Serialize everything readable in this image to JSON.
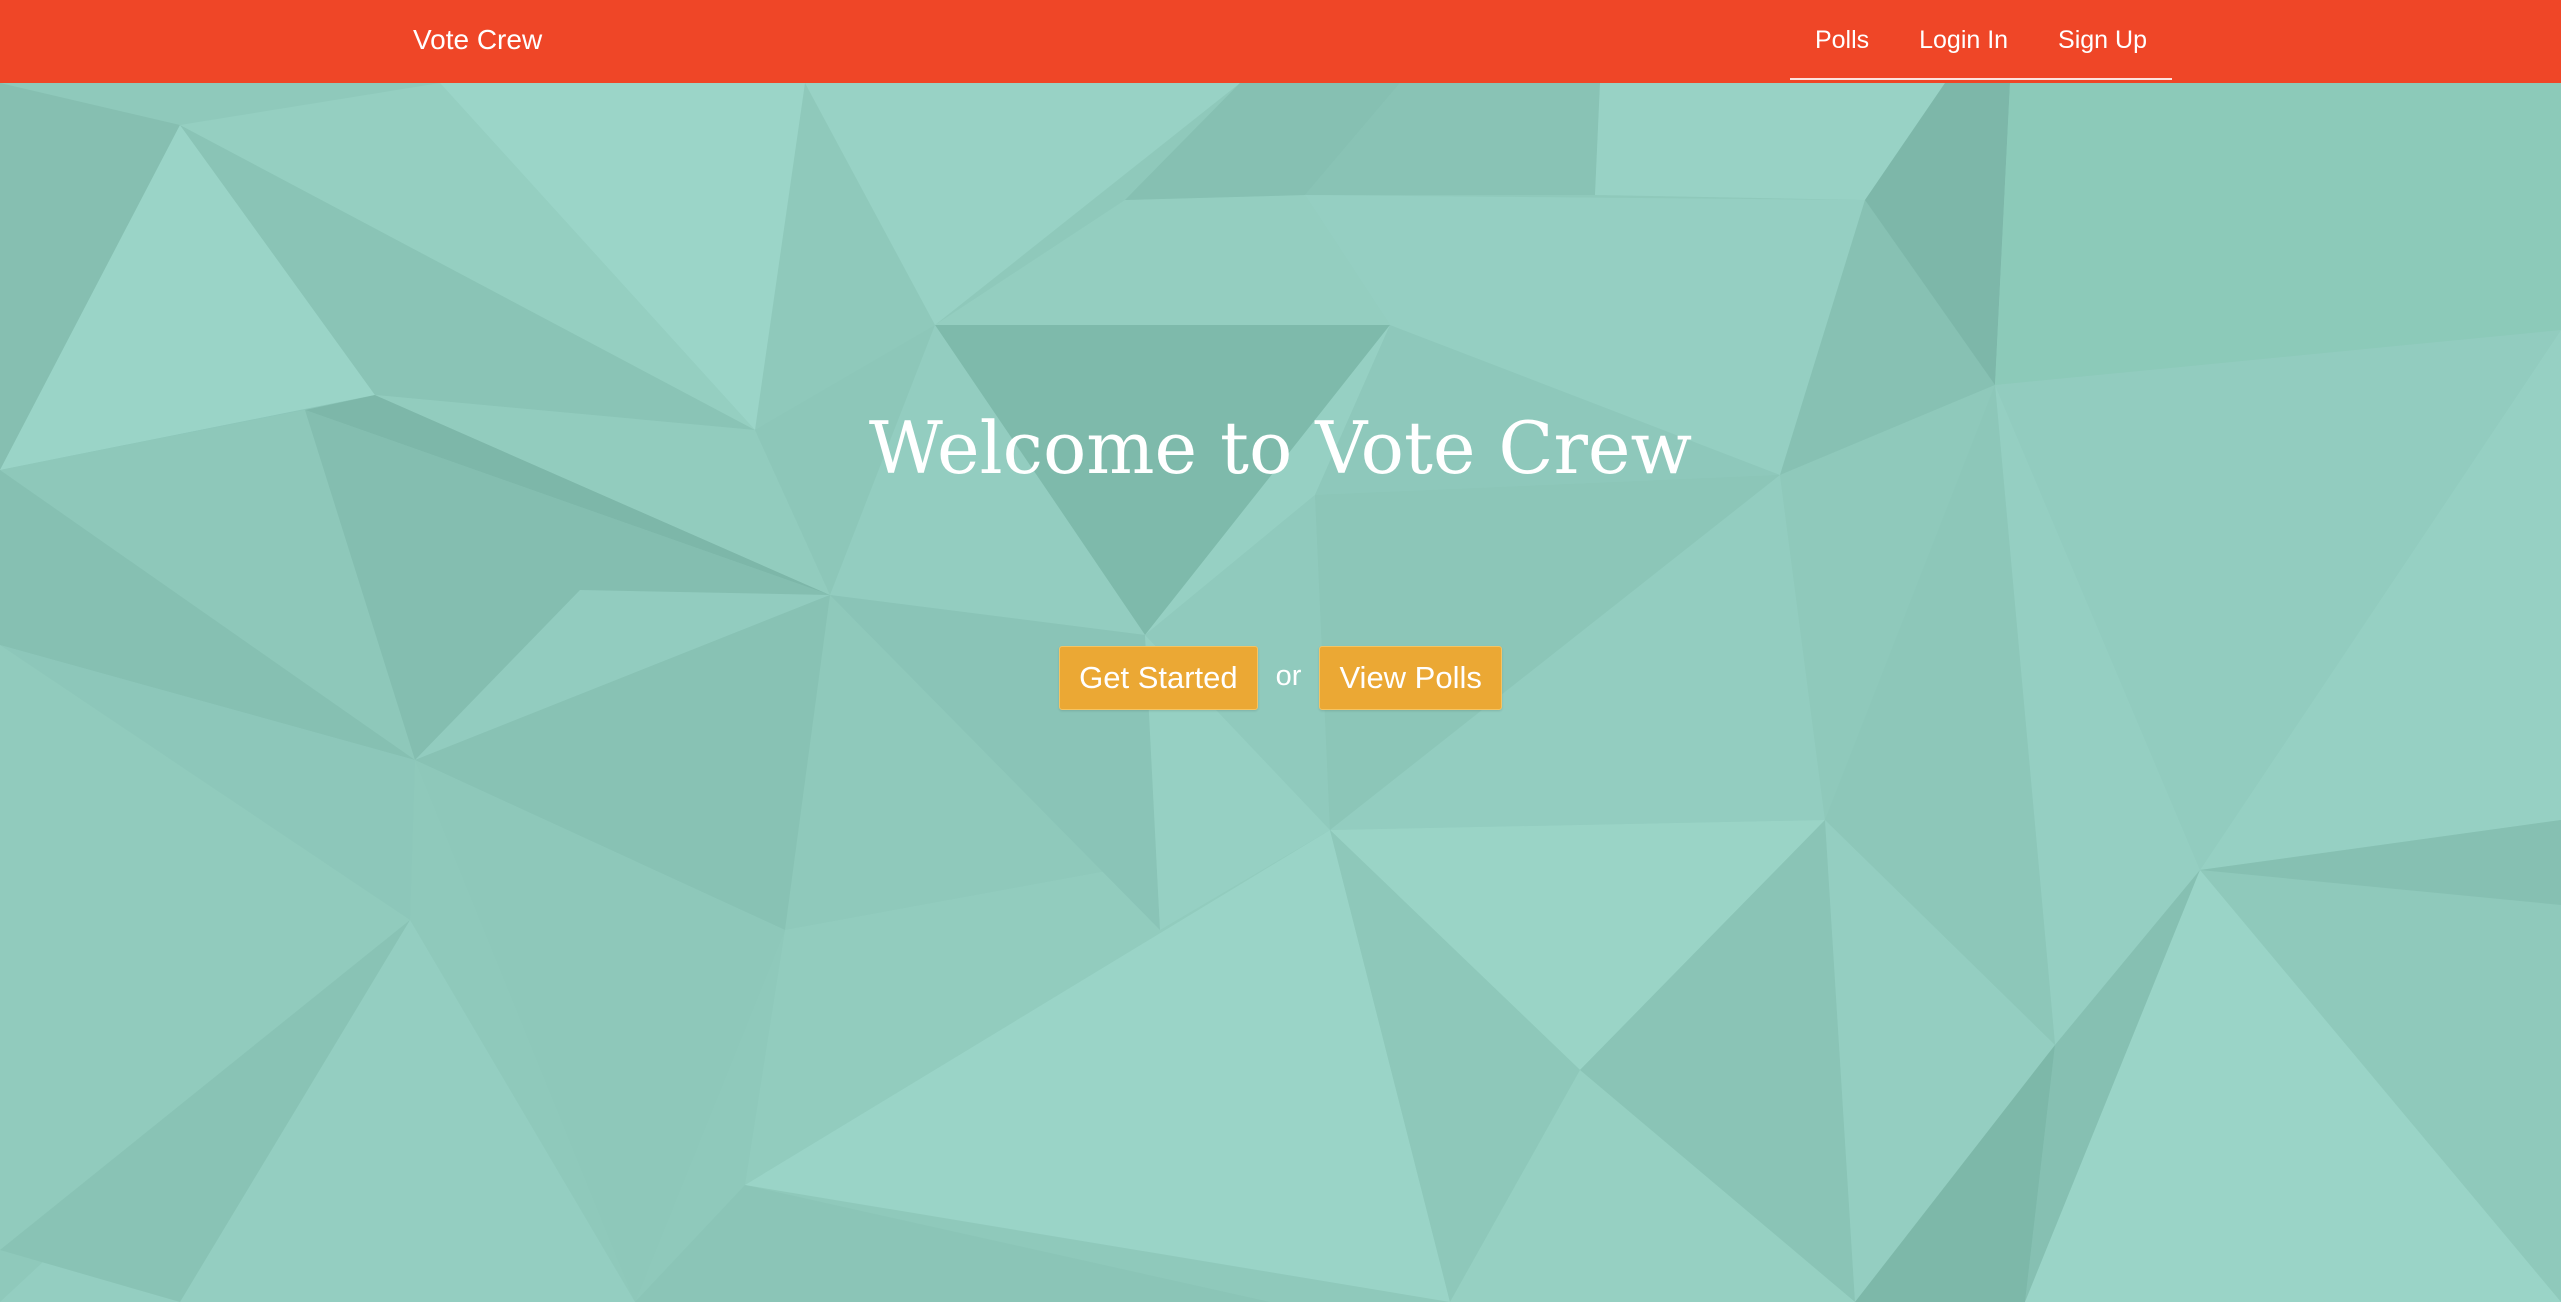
{
  "header": {
    "brand": "Vote Crew",
    "nav": [
      {
        "label": "Polls"
      },
      {
        "label": "Login In"
      },
      {
        "label": "Sign Up"
      }
    ]
  },
  "hero": {
    "title": "Welcome to Vote Crew",
    "get_started_label": "Get Started",
    "or_label": "or",
    "view_polls_label": "View Polls"
  },
  "colors": {
    "header_bg": "#ef4627",
    "button_bg": "#eba834",
    "background_teal": "#8fc9bb"
  }
}
